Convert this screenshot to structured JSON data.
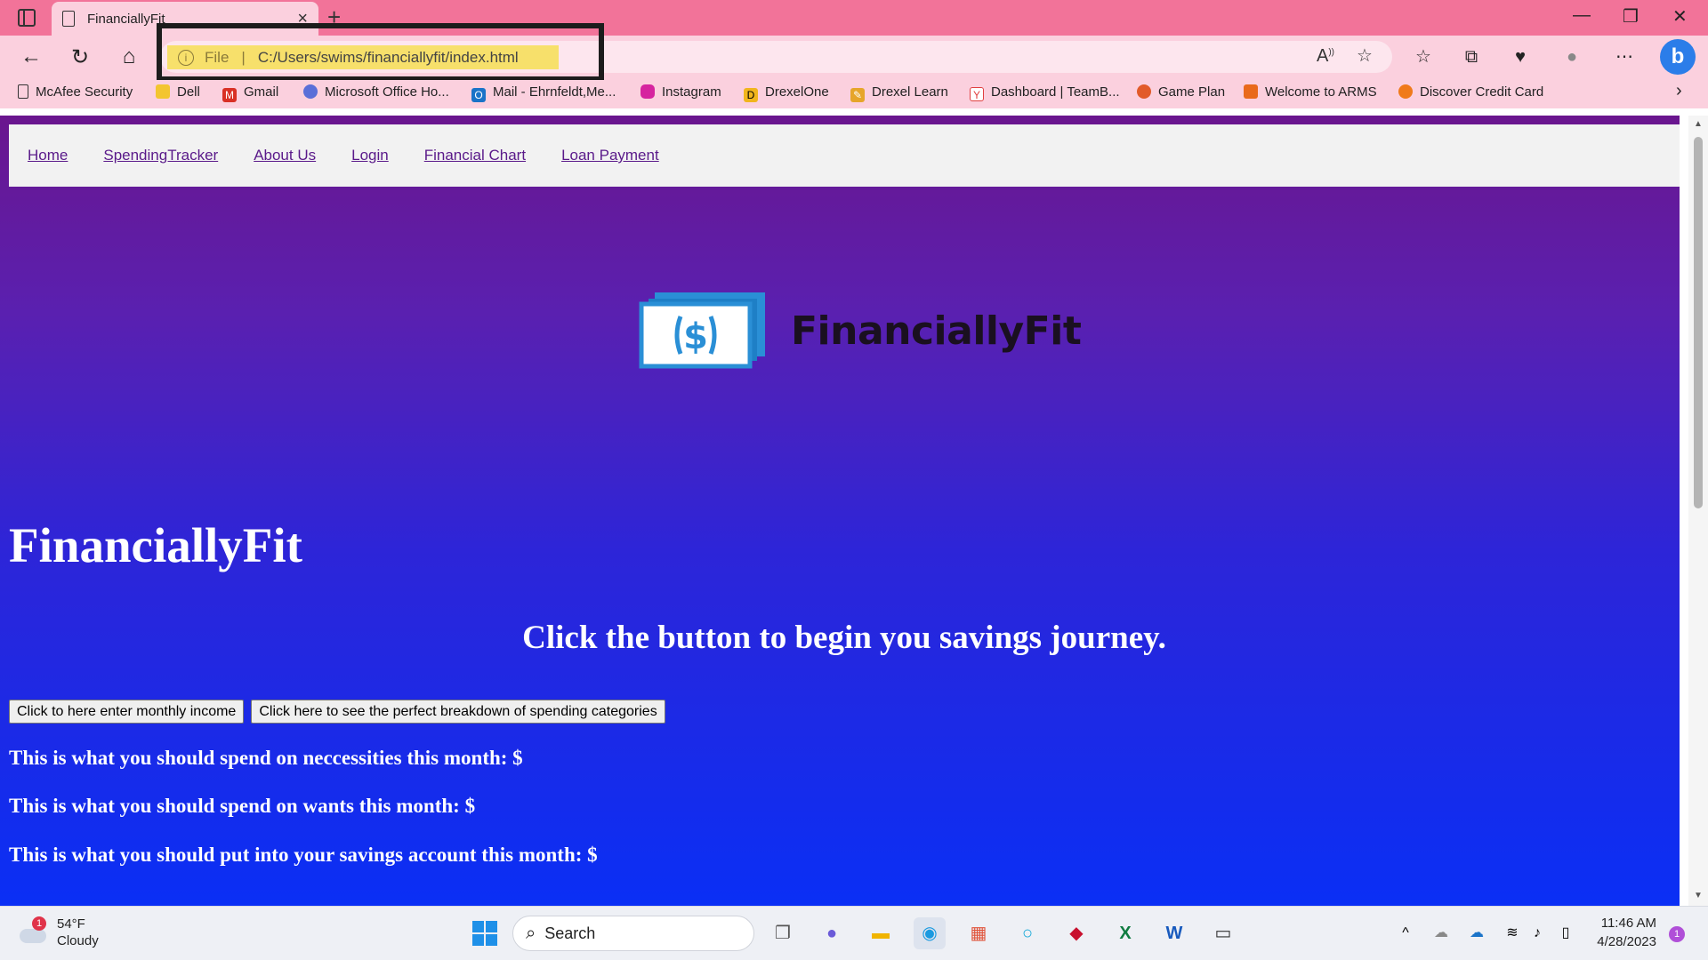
{
  "browser": {
    "tab_title": "FinanciallyFit",
    "close_glyph": "×",
    "newtab_glyph": "+",
    "url_prefix": "File",
    "url_separator": "|",
    "url": "C:/Users/swims/financiallyfit/index.html",
    "minimize_glyph": "—",
    "restore_glyph": "❐",
    "close_window_glyph": "✕",
    "back_glyph": "←",
    "reload_glyph": "↻",
    "home_glyph": "⌂",
    "bing_label": "b",
    "bookmarks_more_glyph": "›",
    "bookmarks": [
      {
        "label": "McAfee Security",
        "icon": "page-icon",
        "color": "#ffffff"
      },
      {
        "label": "Dell",
        "icon": "folder-icon",
        "color": "#f3c530"
      },
      {
        "label": "Gmail",
        "icon": "gmail-icon",
        "color": "#d93025"
      },
      {
        "label": "Microsoft Office Ho...",
        "icon": "office-icon",
        "color": "#5a6fd8"
      },
      {
        "label": "Mail - Ehrnfeldt,Me...",
        "icon": "outlook-icon",
        "color": "#1a73c8"
      },
      {
        "label": "Instagram",
        "icon": "instagram-icon",
        "color": "#d6249f"
      },
      {
        "label": "DrexelOne",
        "icon": "drexel-icon",
        "color": "#f1b51c"
      },
      {
        "label": "Drexel Learn",
        "icon": "pencil-icon",
        "color": "#e6a52a"
      },
      {
        "label": "Dashboard | TeamB...",
        "icon": "teamb-icon",
        "color": "#e04040"
      },
      {
        "label": "Game Plan",
        "icon": "gameplan-icon",
        "color": "#e25b2a"
      },
      {
        "label": "Welcome to ARMS",
        "icon": "arms-icon",
        "color": "#e96a1c"
      },
      {
        "label": "Discover Credit Card",
        "icon": "discover-icon",
        "color": "#f07a1a"
      }
    ]
  },
  "nav": {
    "items": [
      "Home",
      "SpendingTracker",
      "About Us",
      "Login",
      "Financial Chart",
      "Loan Payment"
    ]
  },
  "logo": {
    "text": "FinanciallyFit",
    "symbol": "$"
  },
  "main": {
    "title": "FinanciallyFit",
    "subtitle": "Click the button to begin you savings journey.",
    "button_income": "Click to here enter monthly income",
    "button_breakdown": "Click here to see the perfect breakdown of spending categories",
    "line_necessities": "This is what you should spend on neccessities this month: $",
    "line_wants": "This is what you should spend on wants this month: $",
    "line_savings": "This is what you should put into your savings account this month: $"
  },
  "taskbar": {
    "weather_badge": "1",
    "temperature": "54°F",
    "condition": "Cloudy",
    "search_label": "Search",
    "time": "11:46 AM",
    "date": "4/28/2023",
    "notification_count": "1"
  },
  "colors": {
    "browser_chrome": "#fbd0de",
    "titlebar": "#f27399",
    "url_highlight": "#f7e06b",
    "gradient_top": "#6a168e",
    "gradient_bottom": "#0a2ff5"
  }
}
